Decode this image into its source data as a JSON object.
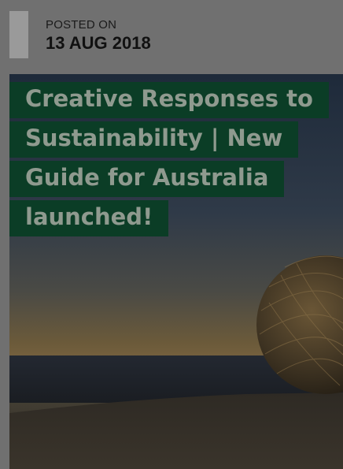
{
  "post": {
    "posted_label": "POSTED ON",
    "posted_date": "13 AUG 2018"
  },
  "article": {
    "title": "Creative Responses to Sustainability | New Guide for Australia launched!"
  },
  "colors": {
    "overlay_gray": "#707070",
    "date_bar": "#9a9a9a",
    "title_highlight": "#0b3d26",
    "title_text": "#8f9a8f"
  },
  "hero_image": {
    "subject": "woven-sphere-sculpture-by-sea-at-dusk"
  }
}
